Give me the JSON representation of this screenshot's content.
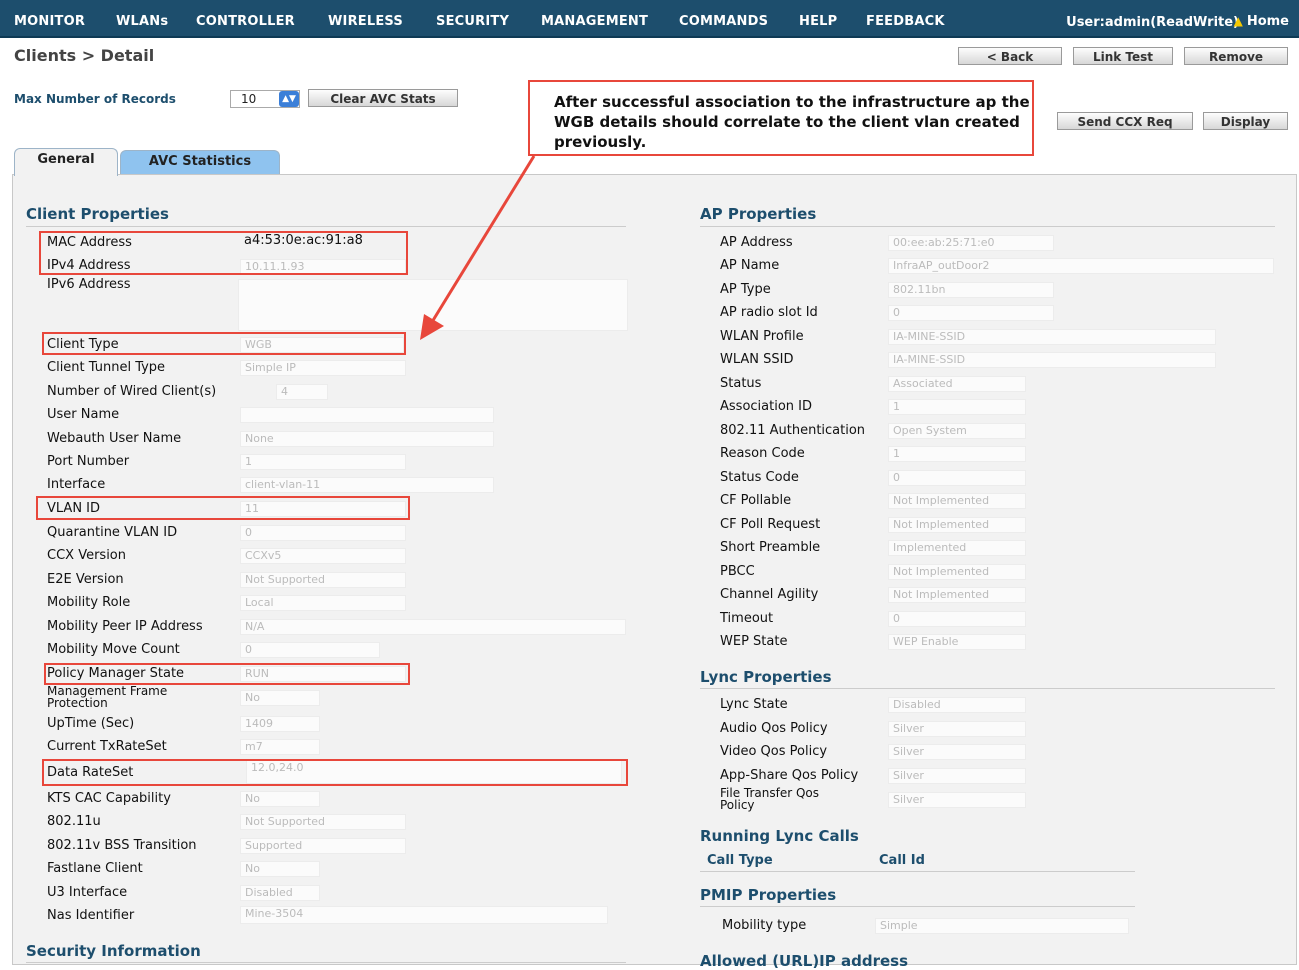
{
  "nav": {
    "items": [
      "MONITOR",
      "WLANs",
      "CONTROLLER",
      "WIRELESS",
      "SECURITY",
      "MANAGEMENT",
      "COMMANDS",
      "HELP",
      "FEEDBACK"
    ],
    "user": "User:admin(ReadWrite)",
    "home": "Home"
  },
  "page": {
    "title": "Clients > Detail",
    "buttons": {
      "back": "< Back",
      "link_test": "Link Test",
      "remove": "Remove",
      "send_ccx": "Send CCX Req",
      "display": "Display"
    },
    "max_records_label": "Max Number of Records",
    "max_records_value": "10",
    "clear_avc": "Clear AVC Stats",
    "annotation": "After successful association to the infrastructure ap the WGB details should correlate to the client vlan created previously."
  },
  "tabs": {
    "general": "General",
    "avc": "AVC Statistics"
  },
  "client": {
    "title": "Client Properties",
    "mac_label": "MAC Address",
    "mac": "a4:53:0e:ac:91:a8",
    "ipv4_label": "IPv4 Address",
    "ipv4": "10.11.1.93",
    "ipv6_label": "IPv6 Address",
    "type_label": "Client Type",
    "type": "WGB",
    "tunnel_label": "Client Tunnel Type",
    "tunnel": "Simple IP",
    "wired_label": "Number of Wired Client(s)",
    "wired": "4",
    "user_label": "User Name",
    "user": "",
    "webauth_label": "Webauth User Name",
    "webauth": "None",
    "port_label": "Port Number",
    "port": "1",
    "iface_label": "Interface",
    "iface": "client-vlan-11",
    "vlan_label": "VLAN ID",
    "vlan": "11",
    "qvlan_label": "Quarantine VLAN ID",
    "qvlan": "0",
    "ccx_label": "CCX Version",
    "ccx": "CCXv5",
    "e2e_label": "E2E Version",
    "e2e": "Not Supported",
    "mrole_label": "Mobility Role",
    "mrole": "Local",
    "mpeer_label": "Mobility Peer IP Address",
    "mpeer": "N/A",
    "mmove_label": "Mobility Move Count",
    "mmove": "0",
    "pms_label": "Policy Manager State",
    "pms": "RUN",
    "mfp_label_1": "Management Frame",
    "mfp_label_2": "Protection",
    "mfp": "No",
    "uptime_label": "UpTime (Sec)",
    "uptime": "1409",
    "txrate_label": "Current TxRateSet",
    "txrate": "m7",
    "datarate_label": "Data RateSet",
    "datarate": "12.0,24.0",
    "kts_label": "KTS CAC Capability",
    "kts": "No",
    "d11u_label": "802.11u",
    "d11u": "Not Supported",
    "bss_label": "802.11v BSS Transition",
    "bss": "Supported",
    "fast_label": "Fastlane Client",
    "fast": "No",
    "u3_label": "U3 Interface",
    "u3": "Disabled",
    "nas_label": "Nas Identifier",
    "nas": "Mine-3504"
  },
  "security_title": "Security Information",
  "ap": {
    "title": "AP Properties",
    "addr_label": "AP Address",
    "addr": "00:ee:ab:25:71:e0",
    "name_label": "AP Name",
    "name": "InfraAP_outDoor2",
    "type_label": "AP Type",
    "type": "802.11bn",
    "slot_label": "AP radio slot Id",
    "slot": "0",
    "wprof_label": "WLAN Profile",
    "wprof": "IA-MINE-SSID",
    "wssid_label": "WLAN SSID",
    "wssid": "IA-MINE-SSID",
    "status_label": "Status",
    "status": "Associated",
    "assoc_label": "Association ID",
    "assoc": "1",
    "auth_label": "802.11 Authentication",
    "auth": "Open System",
    "reason_label": "Reason Code",
    "reason": "1",
    "scode_label": "Status Code",
    "scode": "0",
    "cfp_label": "CF Pollable",
    "cfp": "Not Implemented",
    "cfpr_label": "CF Poll Request",
    "cfpr": "Not Implemented",
    "spre_label": "Short Preamble",
    "spre": "Implemented",
    "pbcc_label": "PBCC",
    "pbcc": "Not Implemented",
    "chag_label": "Channel Agility",
    "chag": "Not Implemented",
    "tout_label": "Timeout",
    "tout": "0",
    "wep_label": "WEP State",
    "wep": "WEP Enable"
  },
  "lync": {
    "title": "Lync Properties",
    "state_label": "Lync State",
    "state": "Disabled",
    "audio_label": "Audio Qos Policy",
    "audio": "Silver",
    "video_label": "Video Qos Policy",
    "video": "Silver",
    "app_label": "App-Share Qos Policy",
    "app": "Silver",
    "ft_label_1": "File Transfer Qos",
    "ft_label_2": "Policy",
    "ft": "Silver"
  },
  "calls": {
    "title": "Running Lync Calls",
    "col1": "Call Type",
    "col2": "Call Id"
  },
  "pmip": {
    "title": "PMIP Properties",
    "mob_label": "Mobility type",
    "mob": "Simple"
  },
  "allowed_title": "Allowed (URL)IP address"
}
